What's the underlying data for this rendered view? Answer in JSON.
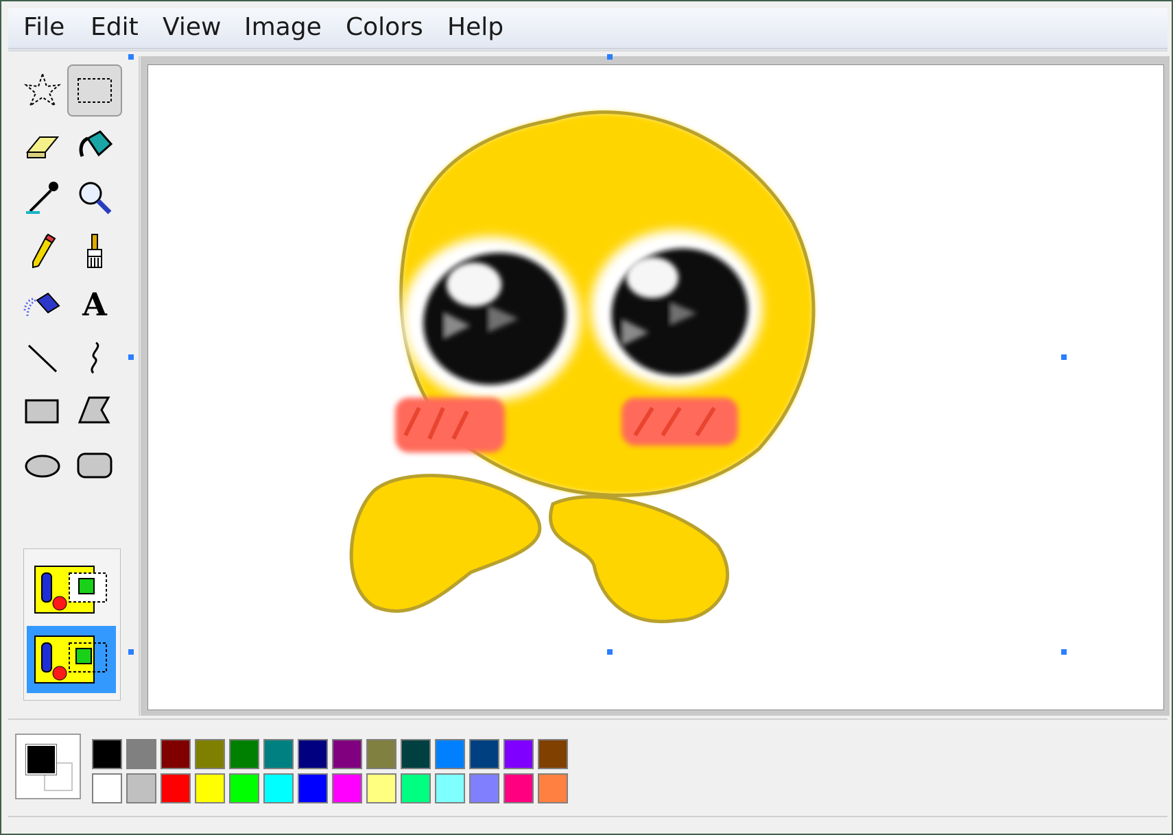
{
  "menu": [
    "File",
    "Edit",
    "View",
    "Image",
    "Colors",
    "Help"
  ],
  "tools": [
    {
      "name": "free-form-select-icon"
    },
    {
      "name": "rect-select-icon",
      "selected": true
    },
    {
      "name": "eraser-icon"
    },
    {
      "name": "fill-bucket-icon"
    },
    {
      "name": "color-picker-icon"
    },
    {
      "name": "magnifier-icon"
    },
    {
      "name": "pencil-icon"
    },
    {
      "name": "brush-icon"
    },
    {
      "name": "airbrush-icon"
    },
    {
      "name": "text-tool-icon",
      "glyph": "A"
    },
    {
      "name": "line-icon"
    },
    {
      "name": "curve-icon"
    },
    {
      "name": "rectangle-icon"
    },
    {
      "name": "polygon-icon"
    },
    {
      "name": "ellipse-icon"
    },
    {
      "name": "rounded-rect-icon"
    }
  ],
  "selection_options": [
    {
      "name": "opaque-selection-icon",
      "selected": false
    },
    {
      "name": "transparent-selection-icon",
      "selected": true
    }
  ],
  "current_colors": {
    "foreground": "#000000",
    "background": "#ffffff"
  },
  "palette": {
    "row1": [
      "#000000",
      "#808080",
      "#800000",
      "#808000",
      "#008000",
      "#008080",
      "#000080",
      "#800080",
      "#808040",
      "#004040",
      "#0080ff",
      "#004080",
      "#8000ff",
      "#804000"
    ],
    "row2": [
      "#ffffff",
      "#c0c0c0",
      "#ff0000",
      "#ffff00",
      "#00ff00",
      "#00ffff",
      "#0000ff",
      "#ff00ff",
      "#ffff80",
      "#00ff80",
      "#80ffff",
      "#8080ff",
      "#ff0080",
      "#ff8040"
    ]
  },
  "drawing": {
    "fill": "#ffd500",
    "outline": "#b8a12c",
    "blush": "#ff6a5a"
  }
}
